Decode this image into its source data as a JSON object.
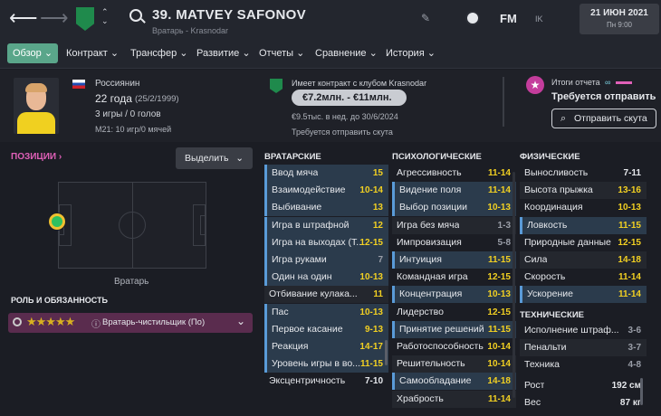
{
  "header": {
    "player_title": "39. MATVEY SAFONOV",
    "subtitle": "Вратарь - Krasnodar",
    "fm_label": "FM",
    "ik_label": "IK",
    "date_main": "21 ИЮН 2021",
    "date_sub": "Пн 9:00"
  },
  "tabs": [
    {
      "label": "Обзор ⌄"
    },
    {
      "label": "Контракт ⌄"
    },
    {
      "label": "Трансфер ⌄"
    },
    {
      "label": "Развитие ⌄"
    },
    {
      "label": "Отчеты ⌄"
    },
    {
      "label": "Сравнение ⌄"
    },
    {
      "label": "История ⌄"
    }
  ],
  "profile": {
    "nationality": "Россиянин",
    "age": "22 года",
    "birth": "(25/2/1999)",
    "games": "3 игры / 0 голов",
    "u21": "М21: 10 игр/0 мячей"
  },
  "contract": {
    "title": "Имеет контракт с клубом Krasnodar",
    "value_range": "€7.2млн. - €11млн.",
    "wage": "€9.5тыс. в нед. до 30/6/2024",
    "scout_needed": "Требуется отправить скута"
  },
  "report": {
    "title": "Итоги отчета",
    "needed": "Требуется отправить ск",
    "button": "Отправить скута"
  },
  "positions": {
    "link": "ПОЗИЦИИ ›",
    "select_label": "Выделить",
    "position_label": "Вратарь",
    "role_heading": "РОЛЬ И ОБЯЗАННОСТЬ",
    "role": "Вратарь-чистильщик (По)",
    "stars": "★★★★★"
  },
  "gk_attrs": {
    "heading": "ВРАТАРСКИЕ",
    "rows": [
      {
        "label": "Ввод мяча",
        "value": "15",
        "hl": true
      },
      {
        "label": "Взаимодействие",
        "value": "10-14",
        "hl": true
      },
      {
        "label": "Выбивание",
        "value": "13",
        "hl": true
      },
      {
        "label": "Игра в штрафной",
        "value": "12",
        "hl": true
      },
      {
        "label": "Игра на выходах (Т...",
        "value": "12-15",
        "hl": true
      },
      {
        "label": "Игра руками",
        "value": "7",
        "hl": true
      },
      {
        "label": "Один на один",
        "value": "10-13",
        "hl": true
      },
      {
        "label": "Отбивание кулака...",
        "value": "11",
        "hl": false
      },
      {
        "label": "Пас",
        "value": "10-13",
        "hl": true
      },
      {
        "label": "Первое касание",
        "value": "9-13",
        "hl": true
      },
      {
        "label": "Реакция",
        "value": "14-17",
        "hl": true
      },
      {
        "label": "Уровень игры в во...",
        "value": "11-15",
        "hl": true
      },
      {
        "label": "Эксцентричность",
        "value": "7-10",
        "hl": false
      }
    ]
  },
  "mental_attrs": {
    "heading": "ПСИХОЛОГИЧЕСКИЕ",
    "rows": [
      {
        "label": "Агрессивность",
        "value": "11-14",
        "hl": false
      },
      {
        "label": "Видение поля",
        "value": "11-14",
        "hl": true
      },
      {
        "label": "Выбор позиции",
        "value": "10-13",
        "hl": true
      },
      {
        "label": "Игра без мяча",
        "value": "1-3",
        "hl": false
      },
      {
        "label": "Импровизация",
        "value": "5-8",
        "hl": false
      },
      {
        "label": "Интуиция",
        "value": "11-15",
        "hl": true
      },
      {
        "label": "Командная игра",
        "value": "12-15",
        "hl": false
      },
      {
        "label": "Концентрация",
        "value": "10-13",
        "hl": true
      },
      {
        "label": "Лидерство",
        "value": "12-15",
        "hl": false
      },
      {
        "label": "Принятие решений",
        "value": "11-15",
        "hl": true
      },
      {
        "label": "Работоспособность",
        "value": "10-14",
        "hl": false
      },
      {
        "label": "Решительность",
        "value": "10-14",
        "hl": false
      },
      {
        "label": "Самообладание",
        "value": "14-18",
        "hl": true
      },
      {
        "label": "Храбрость",
        "value": "11-14",
        "hl": false
      }
    ]
  },
  "physical_attrs": {
    "heading": "ФИЗИЧЕСКИЕ",
    "rows": [
      {
        "label": "Выносливость",
        "value": "7-11",
        "hl": false
      },
      {
        "label": "Высота прыжка",
        "value": "13-16",
        "hl": false
      },
      {
        "label": "Координация",
        "value": "10-13",
        "hl": false
      },
      {
        "label": "Ловкость",
        "value": "11-15",
        "hl": true
      },
      {
        "label": "Природные данные",
        "value": "12-15",
        "hl": false
      },
      {
        "label": "Сила",
        "value": "14-18",
        "hl": false
      },
      {
        "label": "Скорость",
        "value": "11-14",
        "hl": false
      },
      {
        "label": "Ускорение",
        "value": "11-14",
        "hl": true
      }
    ]
  },
  "technical": {
    "heading": "ТЕХНИЧЕСКИЕ",
    "rows": [
      {
        "label": "Исполнение штраф...",
        "value": "3-6"
      },
      {
        "label": "Пенальти",
        "value": "3-7"
      },
      {
        "label": "Техника",
        "value": "4-8"
      }
    ]
  },
  "body": {
    "height_label": "Рост",
    "height": "192 см",
    "weight_label": "Вес",
    "weight": "87 кг"
  },
  "colors": {
    "accent": "#5aa68a",
    "highlight": "#2b3b4c",
    "yellow": "#f2d022",
    "pink": "#e060b8"
  }
}
